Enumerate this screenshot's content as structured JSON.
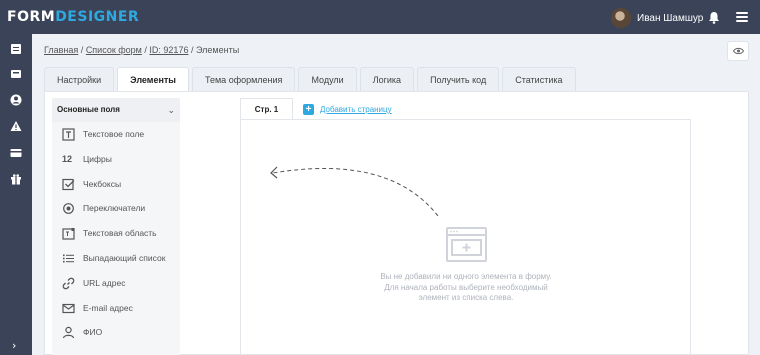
{
  "app": {
    "logo_part1": "FORM",
    "logo_part2": "DESIGNER"
  },
  "user": {
    "name": "Иван Шамшур"
  },
  "icons": {
    "rail": [
      "document-icon",
      "inbox-icon",
      "user-circle-icon",
      "warning-icon",
      "credit-card-icon",
      "gift-icon"
    ],
    "expand": "chevron-right-icon"
  },
  "breadcrumb": {
    "home": "Главная",
    "forms": "Список форм",
    "id": "ID: 92176",
    "current": "Элементы",
    "sep": "/"
  },
  "tabs": [
    "Настройки",
    "Элементы",
    "Тема оформления",
    "Модули",
    "Логика",
    "Получить код",
    "Статистика"
  ],
  "active_tab": "Элементы",
  "fields_panel": {
    "title": "Основные поля",
    "items": [
      {
        "label": "Текстовое поле",
        "icon": "text-field-icon"
      },
      {
        "label": "Цифры",
        "icon": "numbers-icon",
        "glyph": "12"
      },
      {
        "label": "Чекбоксы",
        "icon": "checkbox-icon"
      },
      {
        "label": "Переключатели",
        "icon": "radio-icon"
      },
      {
        "label": "Текстовая область",
        "icon": "textarea-icon"
      },
      {
        "label": "Выпадающий список",
        "icon": "list-icon"
      },
      {
        "label": "URL адрес",
        "icon": "link-icon"
      },
      {
        "label": "E-mail адрес",
        "icon": "envelope-icon"
      },
      {
        "label": "ФИО",
        "icon": "person-icon"
      }
    ]
  },
  "editor": {
    "page_tab": "Стр. 1",
    "add_page": "Добавить страницу",
    "empty_line1": "Вы не добавили ни одного элемента в форму.",
    "empty_line2": "Для начала работы выберите необходимый",
    "empty_line3": "элемент из списка слева."
  },
  "colors": {
    "topbar": "#3b4358",
    "accent": "#2fa8e0"
  }
}
